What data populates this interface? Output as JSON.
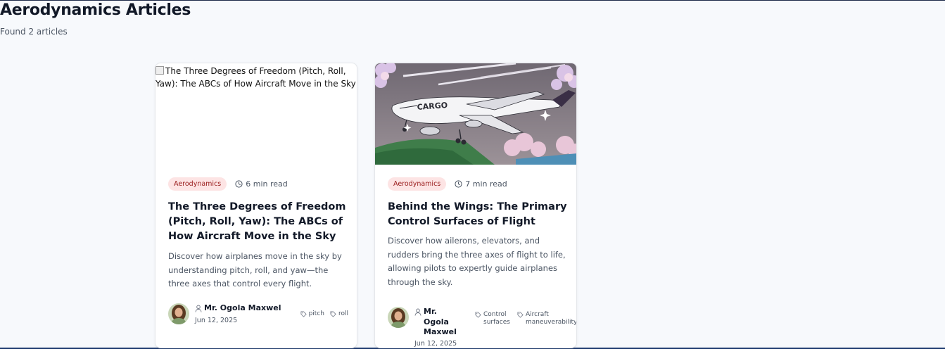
{
  "page": {
    "title": "Aerodynamics Articles",
    "result_count": "Found 2 articles"
  },
  "articles": [
    {
      "image_alt": "The Three Degrees of Freedom (Pitch, Roll, Yaw): The ABCs of How Aircraft Move in the Sky",
      "category": "Aerodynamics",
      "read_time": "6 min read",
      "title": "The Three Degrees of Freedom (Pitch, Roll, Yaw): The ABCs of How Aircraft Move in the Sky",
      "description": "Discover how airplanes move in the sky by understanding pitch, roll, and yaw—the three axes that control every flight.",
      "author": "Mr. Ogola Maxwel",
      "date": "Jun 12, 2025",
      "tags": [
        "pitch",
        "roll"
      ]
    },
    {
      "image_label": "CARGO",
      "category": "Aerodynamics",
      "read_time": "7 min read",
      "title": "Behind the Wings: The Primary Control Surfaces of Flight",
      "description": "Discover how ailerons, elevators, and rudders bring the three axes of flight to life, allowing pilots to expertly guide airplanes through the sky.",
      "author": "Mr. Ogola Maxwel",
      "date": "Jun 12, 2025",
      "tags": [
        "Control surfaces",
        "Aircraft maneuverability"
      ]
    }
  ],
  "colors": {
    "badge_bg": "#fde4e4",
    "badge_text": "#991b1b",
    "title_text": "#111827",
    "muted_text": "#4b5563"
  }
}
